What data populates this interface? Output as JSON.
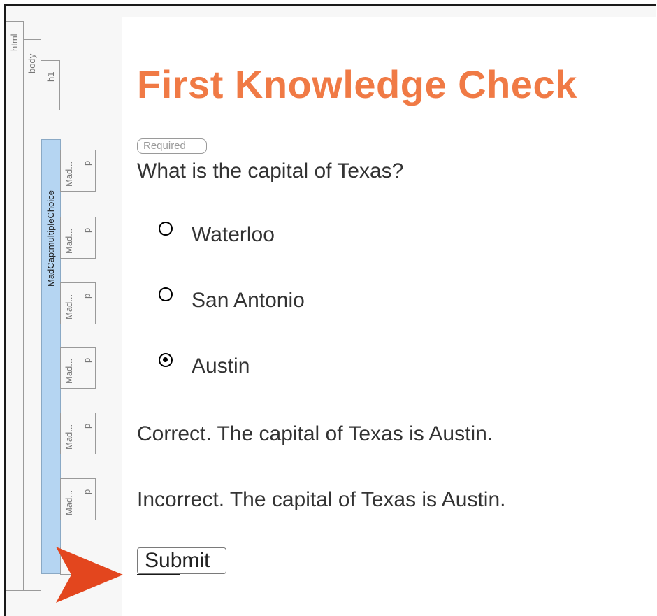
{
  "structure": {
    "html_label": "html",
    "body_label": "body",
    "h1_label": "h1",
    "multiple_choice_label": "MadCap:multipleChoice",
    "rows": [
      {
        "mad": "Mad...",
        "p": "p"
      },
      {
        "mad": "Mad...",
        "p": "p"
      },
      {
        "mad": "Mad...",
        "p": "p"
      },
      {
        "mad": "Mad...",
        "p": "p"
      },
      {
        "mad": "Mad...",
        "p": "p"
      },
      {
        "mad": "Mad...",
        "p": "p"
      }
    ]
  },
  "title": "First Knowledge Check",
  "required_label": "Required",
  "question": "What is the capital of Texas?",
  "options": [
    {
      "label": "Waterloo",
      "selected": false
    },
    {
      "label": "San Antonio",
      "selected": false
    },
    {
      "label": "Austin",
      "selected": true
    }
  ],
  "feedback": {
    "correct": "Correct. The capital of Texas is Austin.",
    "incorrect": "Incorrect. The capital of Texas is Austin."
  },
  "submit_label": "Submit",
  "colors": {
    "title": "#f07a45",
    "arrow": "#e3461e",
    "multiple_choice_bar": "#b5d5f2"
  }
}
